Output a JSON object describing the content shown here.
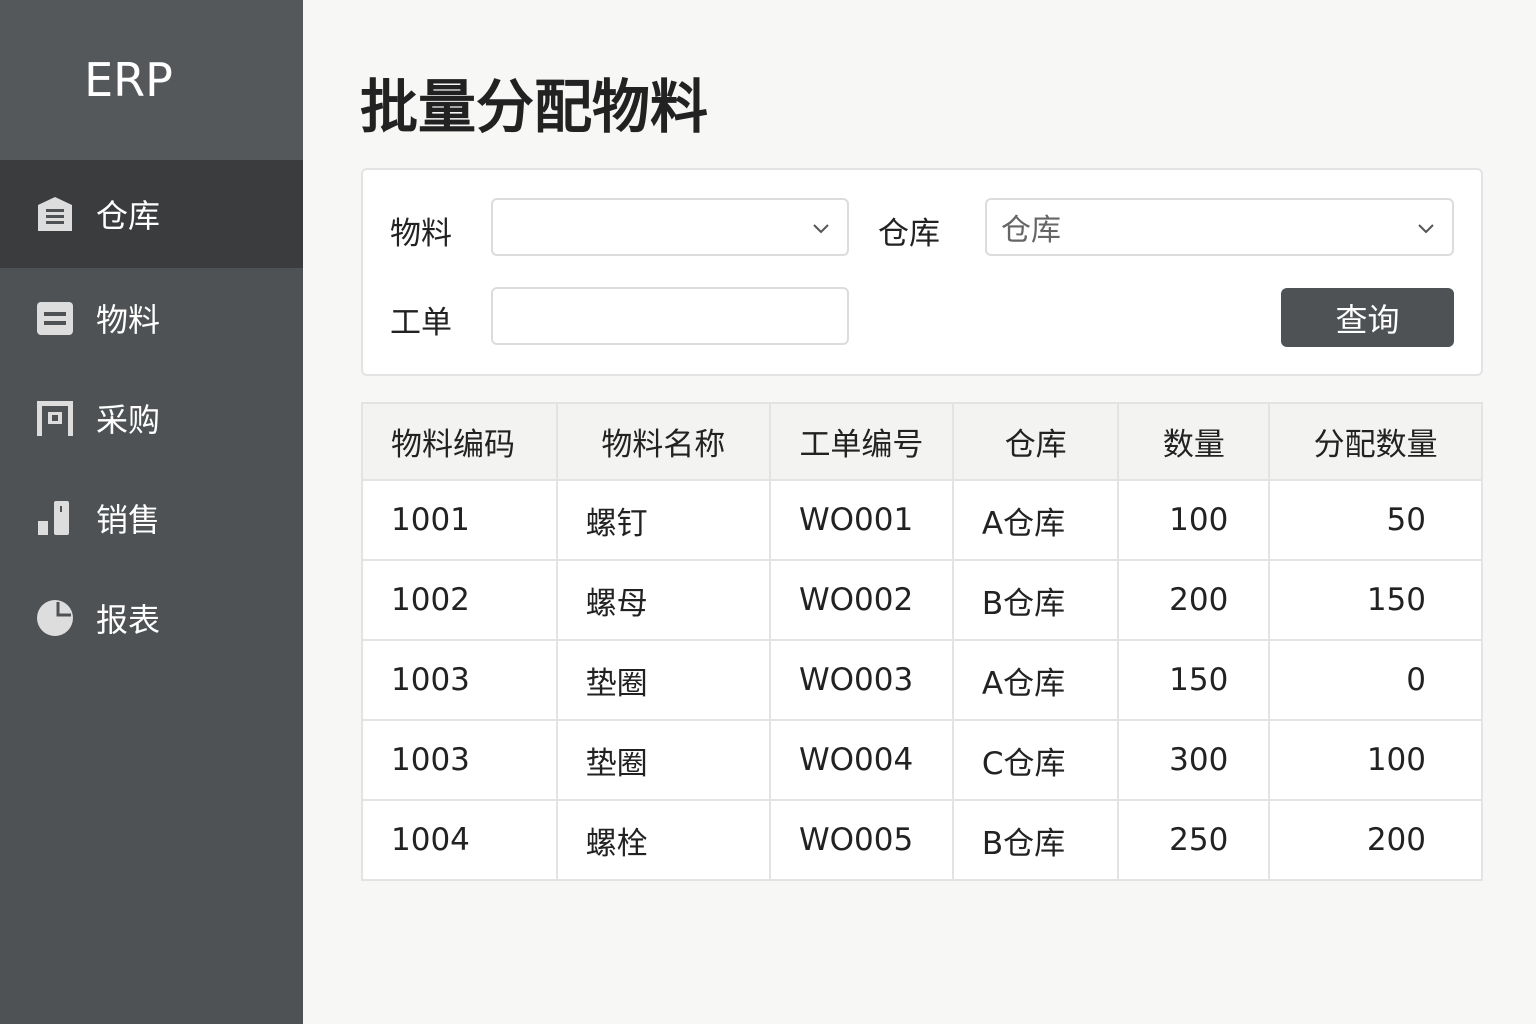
{
  "app": {
    "logo": "ERP"
  },
  "sidebar": {
    "items": [
      {
        "label": "仓库",
        "icon": "warehouse-icon",
        "active": true
      },
      {
        "label": "物料",
        "icon": "material-icon"
      },
      {
        "label": "采购",
        "icon": "purchase-icon"
      },
      {
        "label": "销售",
        "icon": "sales-chart-icon"
      },
      {
        "label": "报表",
        "icon": "pie-chart-icon"
      }
    ]
  },
  "page": {
    "title": "批量分配物料"
  },
  "filter": {
    "material_label": "物料",
    "material_value": "",
    "warehouse_label": "仓库",
    "warehouse_value": "仓库",
    "workorder_label": "工单",
    "workorder_value": "",
    "query_label": "查询"
  },
  "table": {
    "headers": [
      "物料编码",
      "物料名称",
      "工单编号",
      "仓库",
      "数量",
      "分配数量"
    ],
    "rows": [
      [
        "1001",
        "螺钉",
        "WO001",
        "A仓库",
        "100",
        "50"
      ],
      [
        "1002",
        "螺母",
        "WO002",
        "B仓库",
        "200",
        "150"
      ],
      [
        "1003",
        "垫圈",
        "WO003",
        "A仓库",
        "150",
        "0"
      ],
      [
        "1003",
        "垫圈",
        "WO004",
        "C仓库",
        "300",
        "100"
      ],
      [
        "1004",
        "螺栓",
        "WO005",
        "B仓库",
        "250",
        "200"
      ]
    ]
  }
}
